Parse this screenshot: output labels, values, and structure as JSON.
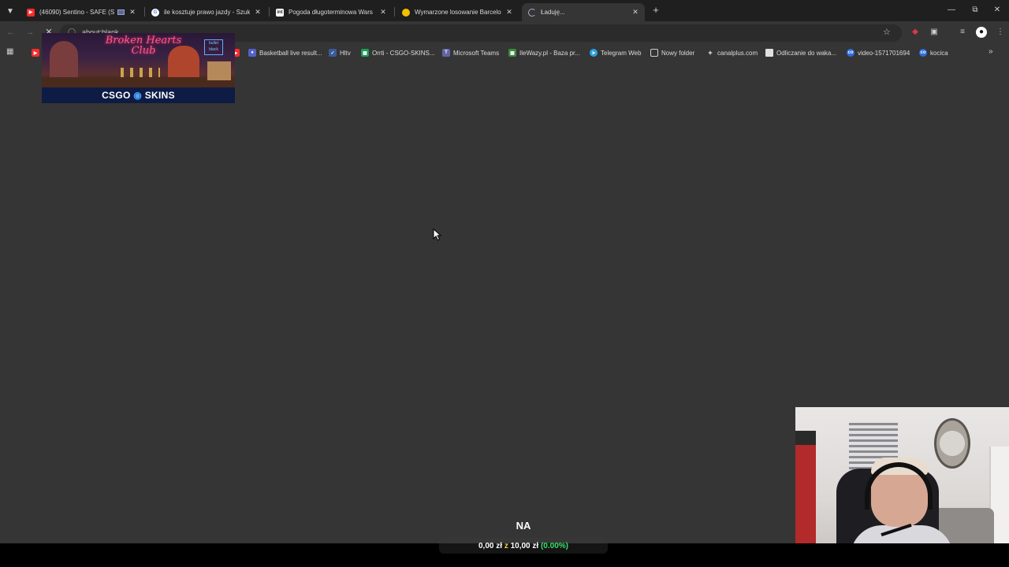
{
  "browser": {
    "tabs": [
      {
        "title": "(46090) Sentino - SAFE (Silo",
        "favicon": "youtube-icon",
        "color": "#ff2a2a",
        "active": false
      },
      {
        "title": "ile kosztuje prawo jazdy - Szuk",
        "favicon": "google-icon",
        "color": "#ffffff",
        "active": false
      },
      {
        "title": "Pogoda długoterminowa Wars",
        "favicon": "weather-icon",
        "color": "#ffffff",
        "active": false
      },
      {
        "title": "Wymarzone losowanie Barcelon",
        "favicon": "dot-icon",
        "color": "#f2c200",
        "active": false
      },
      {
        "title": "Ładuję...",
        "favicon": "loading-icon",
        "color": "#aab4c6",
        "active": true
      }
    ],
    "omnibox": {
      "url": "about:blank"
    },
    "bookmarks": [
      {
        "label": "Basketball live result...",
        "icon": "basketball-icon",
        "color": "#5561c9"
      },
      {
        "label": "Hltv",
        "icon": "hltv-icon",
        "color": "#3a5b9a"
      },
      {
        "label": "Orrti - CSGO-SKINS...",
        "icon": "sheets-icon",
        "color": "#1e9e55"
      },
      {
        "label": "Microsoft Teams",
        "icon": "teams-icon",
        "color": "#6264a7"
      },
      {
        "label": "IleWazy.pl - Baza pr...",
        "icon": "ilewazy-icon",
        "color": "#3e8a3e"
      },
      {
        "label": "Telegram Web",
        "icon": "telegram-icon",
        "color": "#2aa3e0"
      },
      {
        "label": "Nowy folder",
        "icon": "folder-icon",
        "color": "#353535"
      },
      {
        "label": "canalplus.com",
        "icon": "canalplus-icon",
        "color": "#353535"
      },
      {
        "label": "Odliczanie do waka...",
        "icon": "page-icon",
        "color": "#e0e0e0"
      },
      {
        "label": "video-1571701694",
        "icon": "video-icon",
        "color": "#2d6de0"
      },
      {
        "label": "kocica",
        "icon": "video-icon",
        "color": "#2d6de0"
      }
    ]
  },
  "ad": {
    "neon_title": "Broken Hearts Club",
    "sign_text": "bullet black",
    "brand_left": "CSGO",
    "brand_right": "SKINS"
  },
  "stream_goal": {
    "label": "NA",
    "current": "0,00 zł",
    "separator": "z",
    "target": "10,00 zł",
    "percent": "(0.00%)",
    "progress_fraction": 0.0
  }
}
